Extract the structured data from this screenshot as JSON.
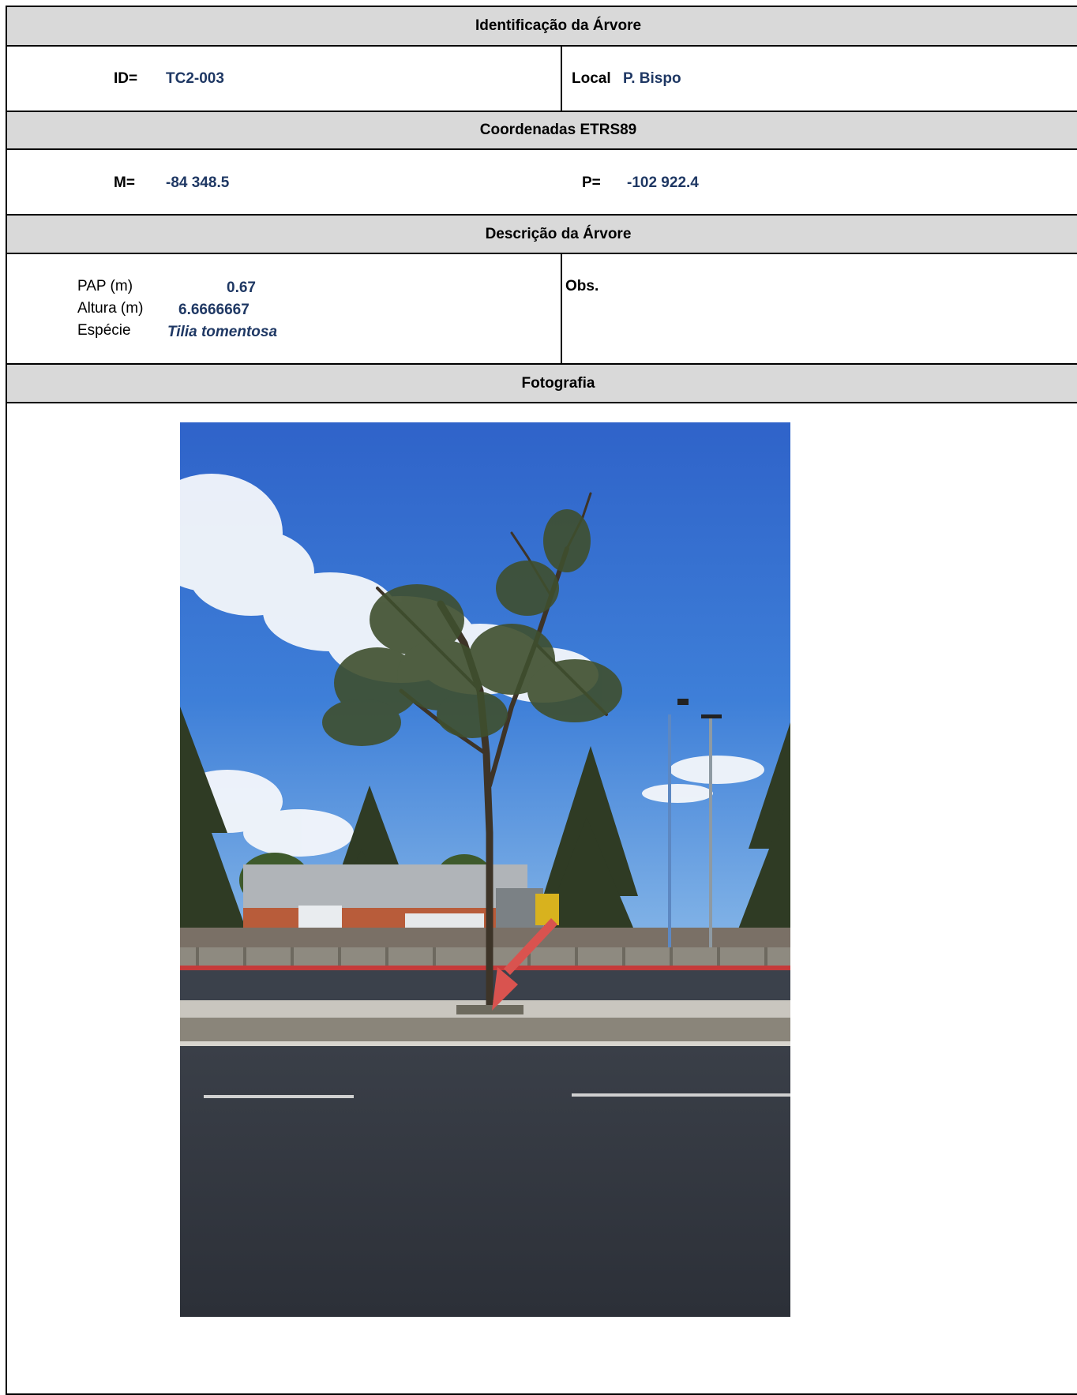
{
  "headers": {
    "identification": "Identificação da Árvore",
    "coordinates": "Coordenadas ETRS89",
    "description": "Descrição da Árvore",
    "photo": "Fotografia"
  },
  "identification": {
    "id_label": "ID=",
    "id_value": "TC2-003",
    "local_label": "Local",
    "local_value": "P. Bispo"
  },
  "coordinates": {
    "m_label": "M=",
    "m_value": "-84 348.5",
    "p_label": "P=",
    "p_value": "-102 922.4"
  },
  "description": {
    "pap_label": "PAP (m)",
    "pap_value": "0.67",
    "altura_label": "Altura (m)",
    "altura_value": "6.6666667",
    "especie_label": "Espécie",
    "especie_value": "Tilia tomentosa",
    "obs_label": "Obs."
  },
  "colors": {
    "header_fill": "#d9d9d9",
    "value_text": "#1f3864",
    "arrow": "#d9534f"
  }
}
